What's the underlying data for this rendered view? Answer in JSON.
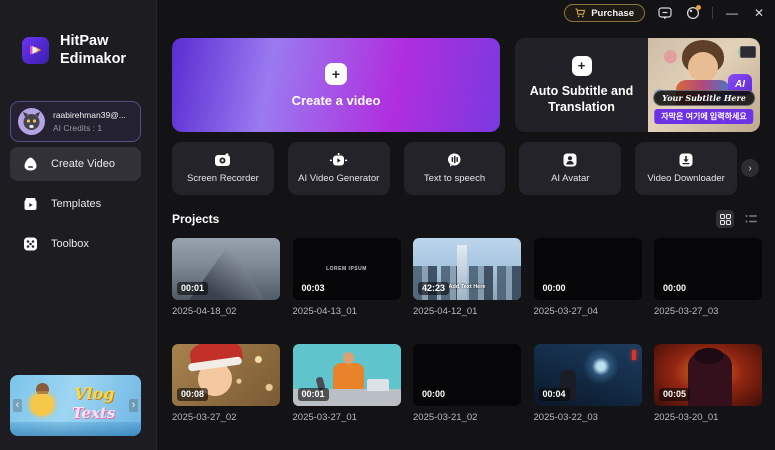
{
  "titlebar": {
    "purchase_label": "Purchase",
    "minimize": "—",
    "close": "✕"
  },
  "sidebar": {
    "brand_line1": "HitPaw",
    "brand_line2": "Edimakor",
    "account": {
      "email": "raabirehman39@...",
      "credits": "AI Credits : 1"
    },
    "nav": [
      {
        "label": "Create Video"
      },
      {
        "label": "Templates"
      },
      {
        "label": "Toolbox"
      }
    ],
    "promo": {
      "word1": "Vlog",
      "word2": "Texts",
      "prev": "‹",
      "next": "›"
    }
  },
  "banners": {
    "create_label": "Create a video",
    "create_plus": "+",
    "subtitle_plus": "+",
    "subtitle_label": "Auto Subtitle and Translation",
    "ai_badge": "AI",
    "subtitle_caption": "Your Subtitle Here",
    "subtitle_caption_kr": "자막은 여기에 입력하세요"
  },
  "tools": {
    "next_arrow": "›",
    "items": [
      {
        "label": "Screen Recorder"
      },
      {
        "label": "AI Video Generator"
      },
      {
        "label": "Text to speech"
      },
      {
        "label": "AI Avatar"
      },
      {
        "label": "Video Downloader"
      }
    ]
  },
  "projects": {
    "title": "Projects",
    "items": [
      {
        "duration": "00:01",
        "name": "2025-04-18_02"
      },
      {
        "duration": "00:03",
        "name": "2025-04-13_01",
        "overlay": "LOREM IPSUM"
      },
      {
        "duration": "42:23",
        "name": "2025-04-12_01",
        "overlay": "Add Text Here"
      },
      {
        "duration": "00:00",
        "name": "2025-03-27_04"
      },
      {
        "duration": "00:00",
        "name": "2025-03-27_03"
      },
      {
        "duration": "00:08",
        "name": "2025-03-27_02"
      },
      {
        "duration": "00:01",
        "name": "2025-03-27_01"
      },
      {
        "duration": "00:00",
        "name": "2025-03-21_02"
      },
      {
        "duration": "00:04",
        "name": "2025-03-22_03"
      },
      {
        "duration": "00:05",
        "name": "2025-03-20_01"
      }
    ]
  },
  "colors": {
    "accent_purple": "#7c3aed",
    "gold": "#d2a24c",
    "badge_orange": "#f09a3a"
  }
}
